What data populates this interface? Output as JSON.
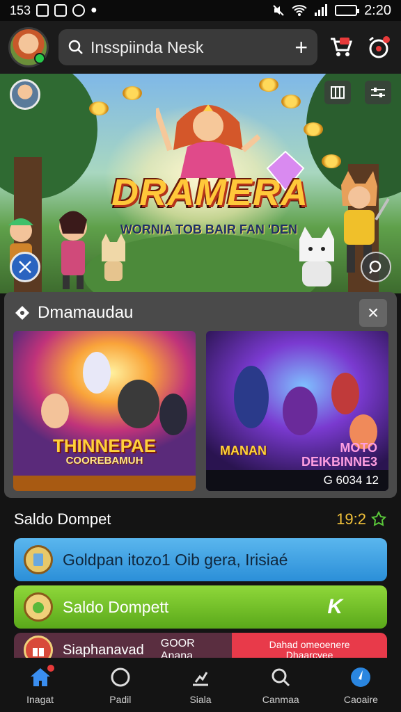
{
  "status_bar": {
    "left_text": "153",
    "time": "2:20"
  },
  "header": {
    "search_text": "Insspiinda Nesk",
    "plus_label": "+"
  },
  "hero": {
    "title": "DRAMERA",
    "subtitle": "WORNIA TOB BAIR FAN 'DEN"
  },
  "popup": {
    "title": "Dmamaudau",
    "close_label": "×",
    "cards": [
      {
        "title": "THINNEPAE",
        "subtitle": "COOREBAMUH"
      },
      {
        "title": "MANAN",
        "subtitle_line1": "MOTO",
        "subtitle_line2": "DEIKBINNE3",
        "footer": "G 6034 12"
      }
    ]
  },
  "balance": {
    "label": "Saldo Dompet",
    "value": "19:2"
  },
  "actions": [
    {
      "label": "Goldpan itozo1 Oib gera, Irisiaé"
    },
    {
      "label": "Saldo Dompett",
      "badge": "K"
    },
    {
      "label": "Siaphanavad",
      "extra": "GOOR Anana.",
      "red_line1": "Dahad omeoenere",
      "red_line2": "Dhaarcyee"
    }
  ],
  "nav": [
    {
      "label": "Inagat"
    },
    {
      "label": "Padil"
    },
    {
      "label": "Siala"
    },
    {
      "label": "Canmaa"
    },
    {
      "label": "Caoaire"
    }
  ],
  "colors": {
    "accent_blue": "#2b8fd8",
    "accent_green": "#5aa81a",
    "accent_red": "#e83a4a",
    "gold": "#f2c23a"
  },
  "icons": [
    "search-icon",
    "cart-icon",
    "alarm-icon",
    "close-icon",
    "home-icon",
    "chat-icon",
    "stats-icon",
    "search-nav-icon",
    "compass-icon"
  ]
}
